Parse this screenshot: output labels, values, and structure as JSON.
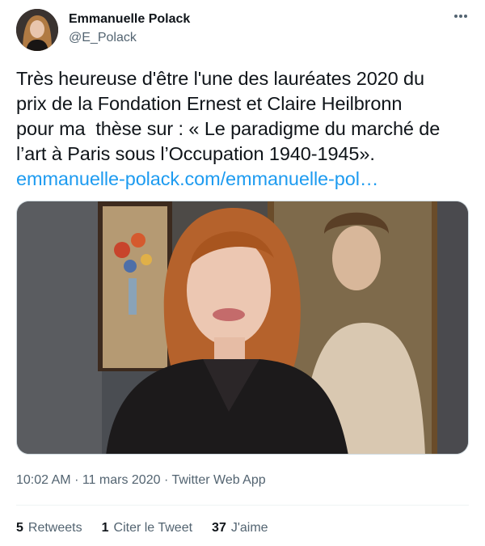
{
  "tweet": {
    "author_name": "Emmanuelle Polack",
    "author_handle": "@E_Polack",
    "text": "Très heureuse d'être l'une des lauréates 2020 du\nprix de la Fondation Ernest et Claire Heilbronn\npour ma  thèse sur : « Le paradigme du marché de\nl’art à Paris sous l’Occupation 1940-1945».",
    "link": "emmanuelle-polack.com/emmanuelle-pol…",
    "time": "10:02 AM",
    "date": "11 mars 2020",
    "source": "Twitter Web App",
    "separator": "·",
    "retweets_count": "5",
    "retweets_label": "Retweets",
    "quotes_count": "1",
    "quotes_label": "Citer le Tweet",
    "likes_count": "37",
    "likes_label": "J'aime"
  },
  "colors": {
    "link": "#1d9bf0",
    "muted": "#536471",
    "text": "#0f1419"
  },
  "icons": {
    "more": "more-dots-icon"
  }
}
